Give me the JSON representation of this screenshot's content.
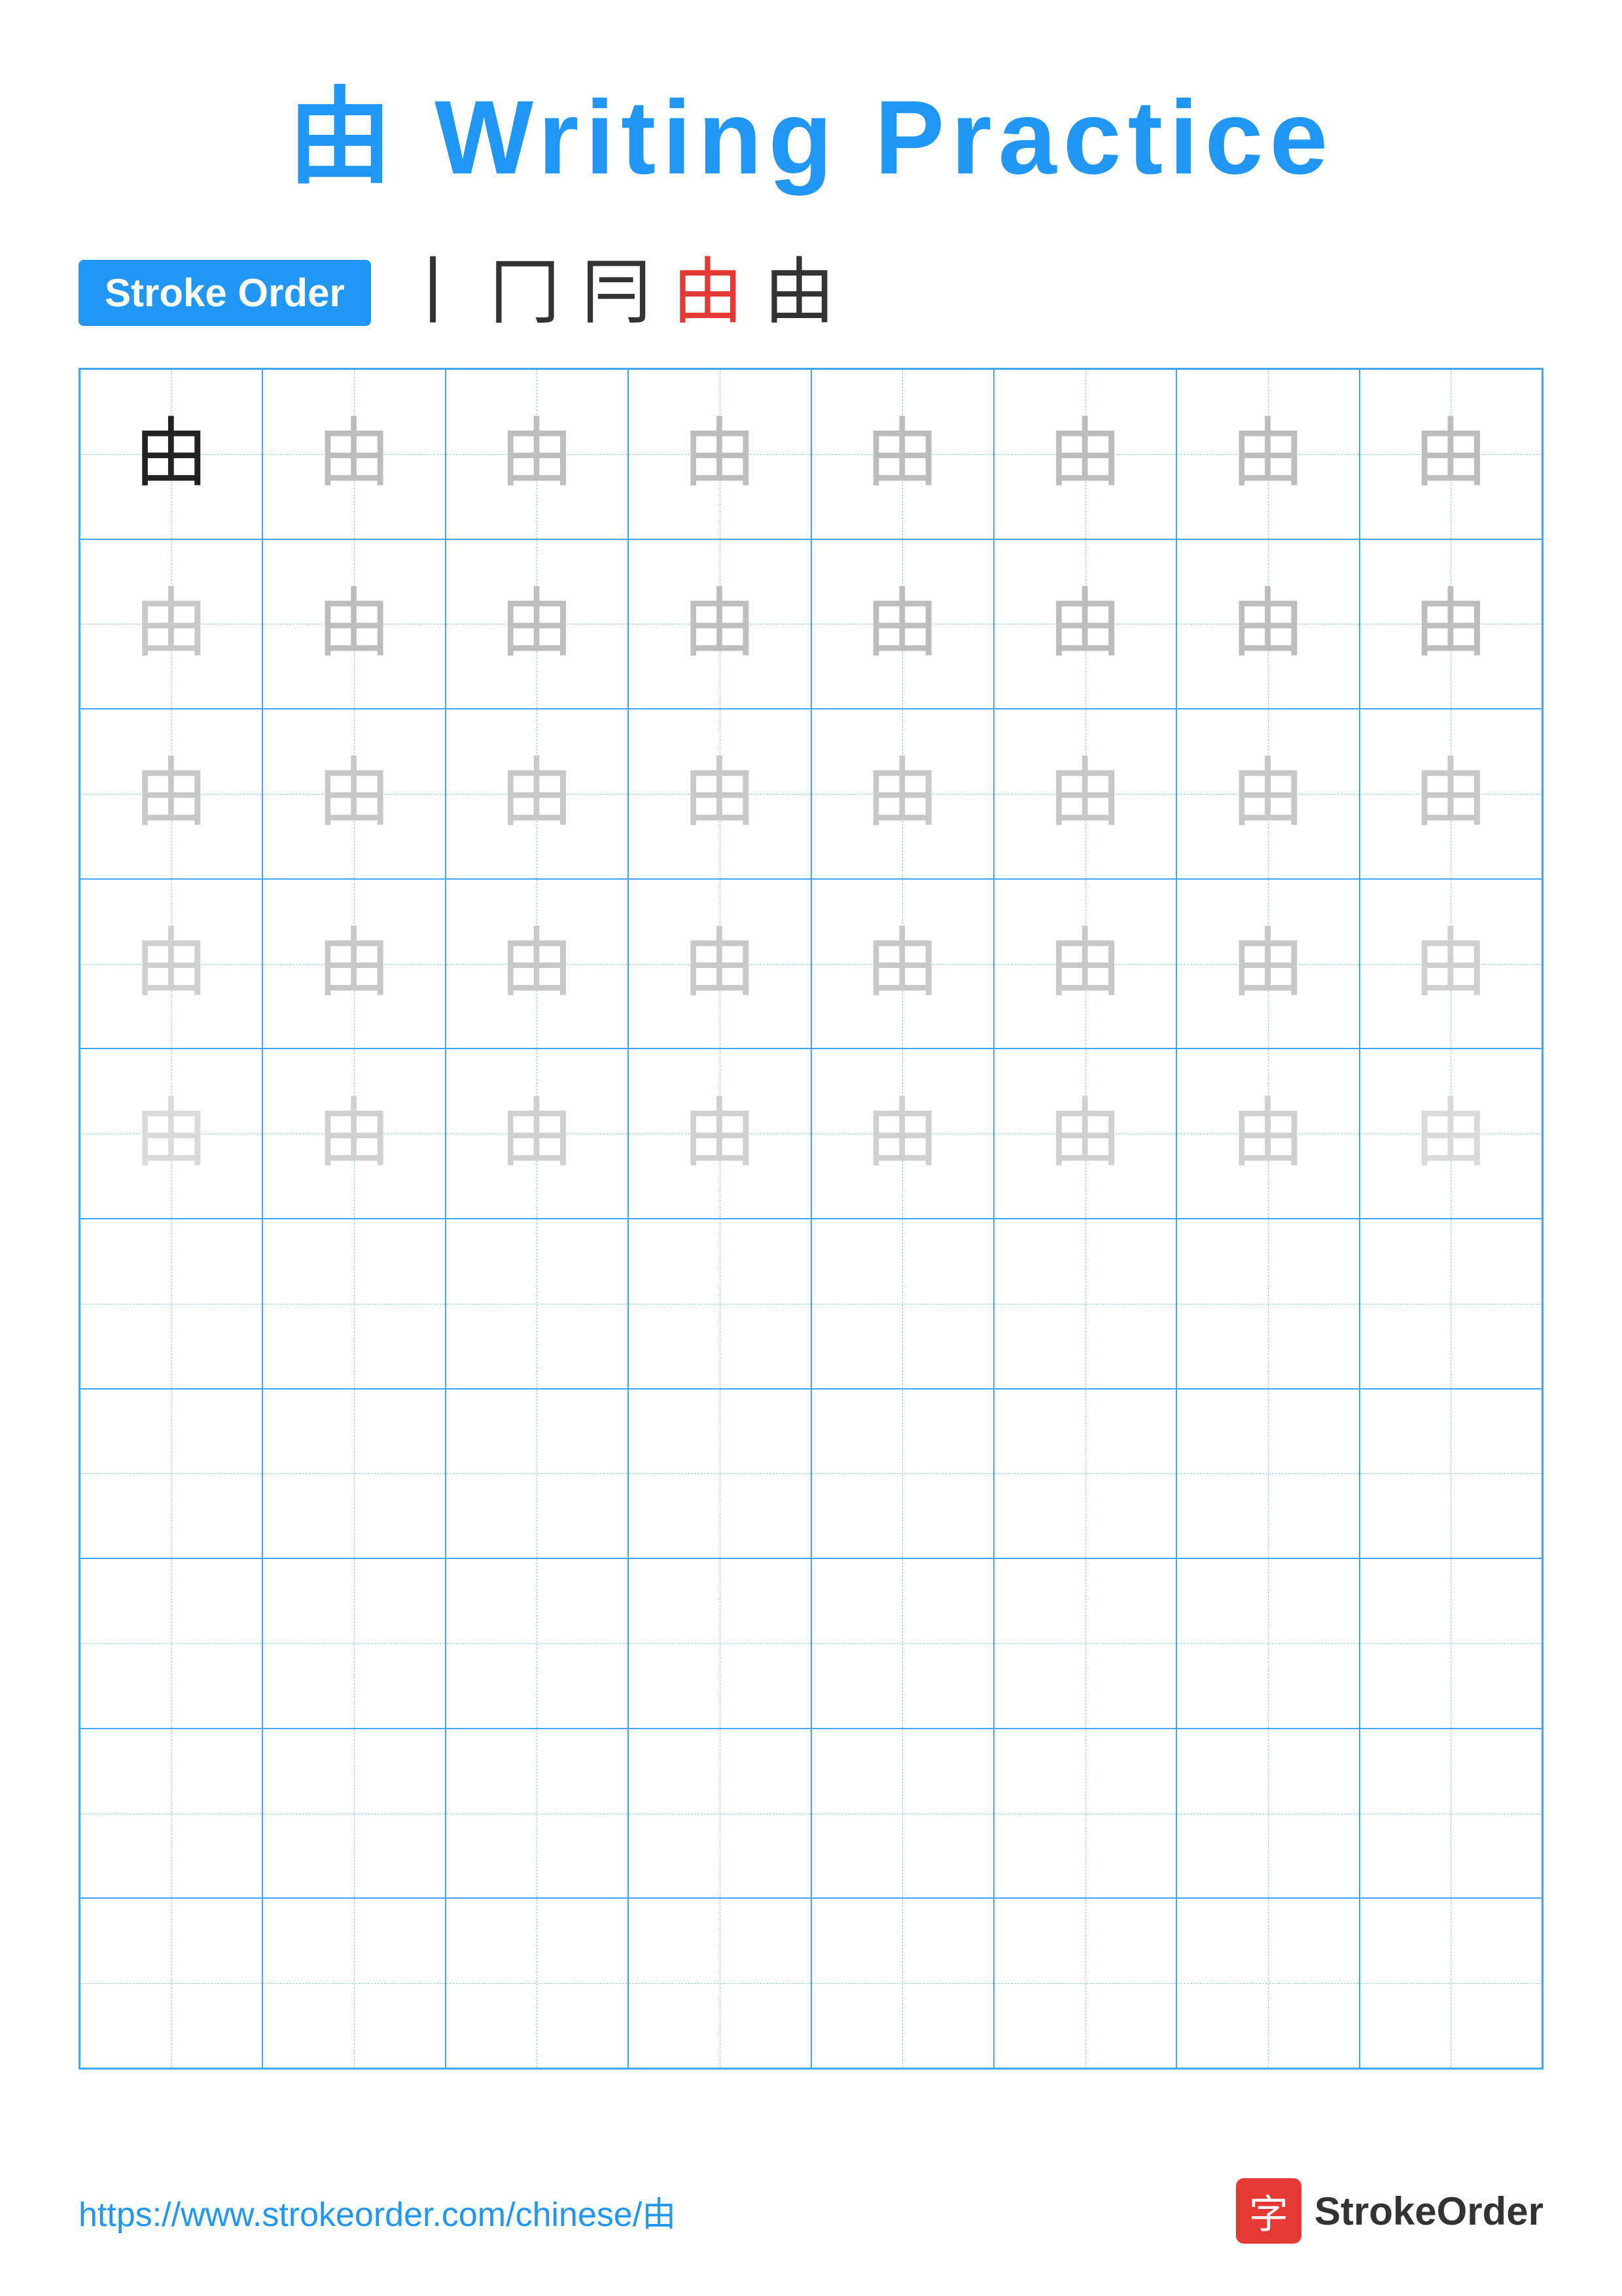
{
  "title": {
    "char": "由",
    "text": "Writing Practice"
  },
  "stroke_order": {
    "badge_label": "Stroke Order",
    "chars": [
      "丨",
      "冂",
      "冃",
      "由",
      "由"
    ]
  },
  "grid": {
    "rows": 10,
    "cols": 8,
    "chars": [
      [
        "由",
        "由",
        "由",
        "由",
        "由",
        "由",
        "由",
        "由"
      ],
      [
        "由",
        "由",
        "由",
        "由",
        "由",
        "由",
        "由",
        "由"
      ],
      [
        "由",
        "由",
        "由",
        "由",
        "由",
        "由",
        "由",
        "由"
      ],
      [
        "由",
        "由",
        "由",
        "由",
        "由",
        "由",
        "由",
        "由"
      ],
      [
        "由",
        "由",
        "由",
        "由",
        "由",
        "由",
        "由",
        "由"
      ],
      [
        "",
        "",
        "",
        "",
        "",
        "",
        "",
        ""
      ],
      [
        "",
        "",
        "",
        "",
        "",
        "",
        "",
        ""
      ],
      [
        "",
        "",
        "",
        "",
        "",
        "",
        "",
        ""
      ],
      [
        "",
        "",
        "",
        "",
        "",
        "",
        "",
        ""
      ],
      [
        "",
        "",
        "",
        "",
        "",
        "",
        "",
        ""
      ]
    ],
    "char_classes": [
      [
        "char-dark",
        "char-gray1",
        "char-gray1",
        "char-gray1",
        "char-gray1",
        "char-gray1",
        "char-gray1",
        "char-gray1"
      ],
      [
        "char-gray2",
        "char-gray1",
        "char-gray1",
        "char-gray1",
        "char-gray1",
        "char-gray1",
        "char-gray1",
        "char-gray1"
      ],
      [
        "char-gray2",
        "char-gray2",
        "char-gray2",
        "char-gray2",
        "char-gray2",
        "char-gray2",
        "char-gray2",
        "char-gray2"
      ],
      [
        "char-gray3",
        "char-gray2",
        "char-gray2",
        "char-gray2",
        "char-gray2",
        "char-gray2",
        "char-gray2",
        "char-gray3"
      ],
      [
        "char-gray4",
        "char-gray3",
        "char-gray3",
        "char-gray3",
        "char-gray3",
        "char-gray3",
        "char-gray3",
        "char-gray4"
      ],
      [
        "",
        "",
        "",
        "",
        "",
        "",
        "",
        ""
      ],
      [
        "",
        "",
        "",
        "",
        "",
        "",
        "",
        ""
      ],
      [
        "",
        "",
        "",
        "",
        "",
        "",
        "",
        ""
      ],
      [
        "",
        "",
        "",
        "",
        "",
        "",
        "",
        ""
      ],
      [
        "",
        "",
        "",
        "",
        "",
        "",
        "",
        ""
      ]
    ]
  },
  "footer": {
    "url": "https://www.strokeorder.com/chinese/由",
    "brand_icon": "字",
    "brand_name": "StrokeOrder"
  }
}
